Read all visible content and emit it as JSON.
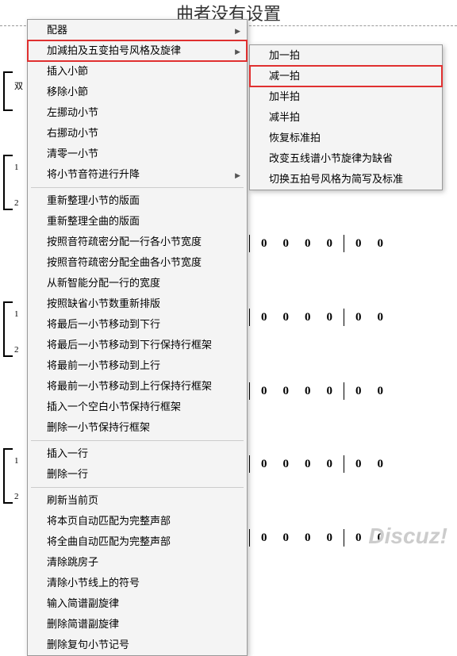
{
  "page_title": "曲者没有设置",
  "watermark": "Discuz!",
  "main_menu": {
    "groups": [
      [
        {
          "label": "配器",
          "has_sub": true
        },
        {
          "label": "加減拍及五变拍号风格及旋律",
          "has_sub": true,
          "highlight": true
        },
        {
          "label": "插入小節"
        },
        {
          "label": "移除小節"
        },
        {
          "label": "左挪动小节"
        },
        {
          "label": "右挪动小节"
        },
        {
          "label": "清零一小节"
        },
        {
          "label": "将小节音符进行升降",
          "has_sub": true
        }
      ],
      [
        {
          "label": "重新整理小节的版面"
        },
        {
          "label": "重新整理全曲的版面"
        },
        {
          "label": "按照音符疏密分配一行各小节宽度"
        },
        {
          "label": "按照音符疏密分配全曲各小节宽度"
        },
        {
          "label": "从新智能分配一行的宽度"
        },
        {
          "label": "按照缺省小节数重新排版"
        },
        {
          "label": "将最后一小节移动到下行"
        },
        {
          "label": "将最后一小节移动到下行保持行框架"
        },
        {
          "label": "将最前一小节移动到上行"
        },
        {
          "label": "将最前一小节移动到上行保持行框架"
        },
        {
          "label": "插入一个空白小节保持行框架"
        },
        {
          "label": "删除一小节保持行框架"
        }
      ],
      [
        {
          "label": "插入一行"
        },
        {
          "label": "删除一行"
        }
      ],
      [
        {
          "label": "刷新当前页"
        },
        {
          "label": "将本页自动匹配为完整声部"
        },
        {
          "label": "将全曲自动匹配为完整声部"
        },
        {
          "label": "清除跳房子"
        },
        {
          "label": "清除小节线上的符号"
        },
        {
          "label": "输入简谱副旋律"
        },
        {
          "label": "删除简谱副旋律"
        },
        {
          "label": "删除复句小节记号"
        }
      ]
    ]
  },
  "sub_menu": {
    "items": [
      {
        "label": "加一拍"
      },
      {
        "label": "减一拍",
        "highlight": true
      },
      {
        "label": "加半拍"
      },
      {
        "label": "减半拍"
      },
      {
        "label": "恢复标准拍"
      },
      {
        "label": "改变五线谱小节旋律为缺省"
      },
      {
        "label": "切换五拍号风格为简写及标准"
      }
    ]
  },
  "score": {
    "note_char": "0",
    "left_labels": [
      "双",
      "1",
      "2",
      "1",
      "2",
      "1",
      "2"
    ]
  }
}
